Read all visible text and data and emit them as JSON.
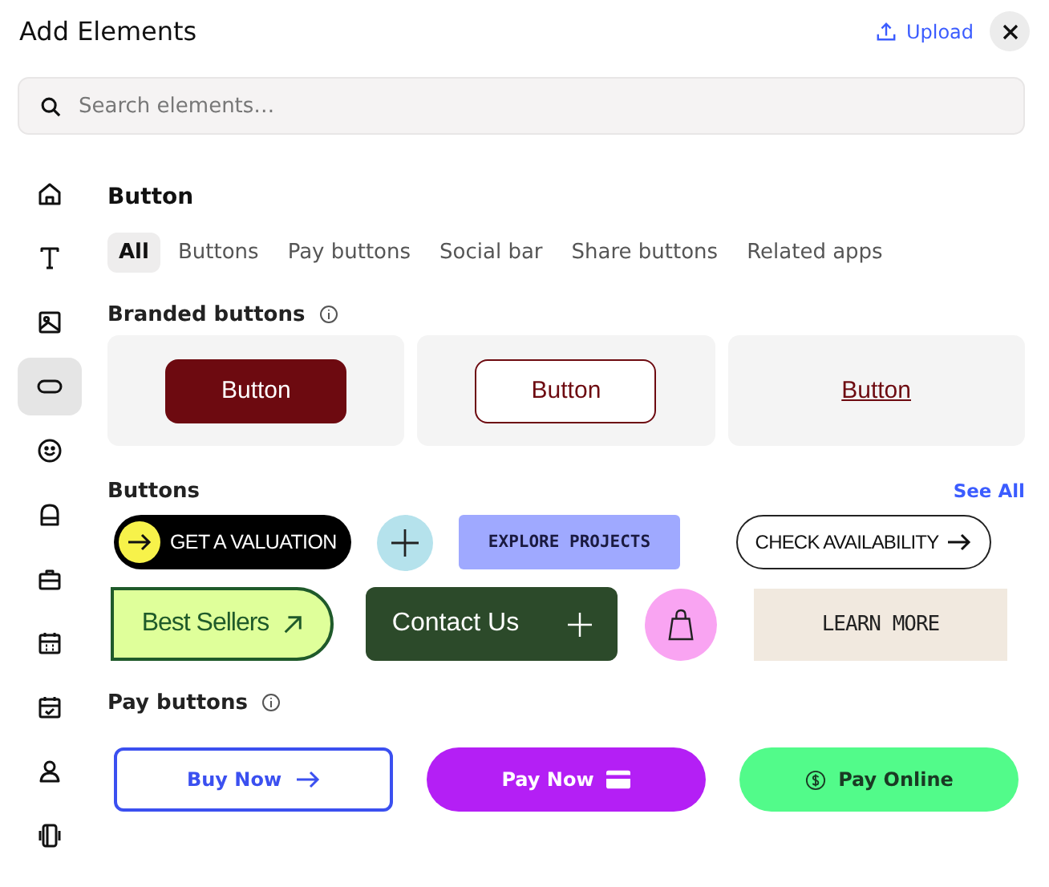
{
  "window": {
    "title": "Add Elements",
    "upload": "Upload"
  },
  "search": {
    "placeholder": "Search elements…"
  },
  "sidebar": {
    "items": [
      {
        "kind": "home",
        "selected": false
      },
      {
        "kind": "text",
        "selected": false
      },
      {
        "kind": "image",
        "selected": false
      },
      {
        "kind": "button",
        "selected": true
      },
      {
        "kind": "smiley",
        "selected": false
      },
      {
        "kind": "bag",
        "selected": false
      },
      {
        "kind": "briefcase",
        "selected": false
      },
      {
        "kind": "calendar",
        "selected": false
      },
      {
        "kind": "calendar-check",
        "selected": false
      },
      {
        "kind": "person",
        "selected": false
      },
      {
        "kind": "phone",
        "selected": false
      }
    ]
  },
  "heading": "Button",
  "tabs": [
    {
      "label": "All",
      "selected": true
    },
    {
      "label": "Buttons",
      "selected": false
    },
    {
      "label": "Pay buttons",
      "selected": false
    },
    {
      "label": "Social bar",
      "selected": false
    },
    {
      "label": "Share buttons",
      "selected": false
    },
    {
      "label": "Related apps",
      "selected": false
    }
  ],
  "branded": {
    "title": "Branded buttons",
    "items": [
      {
        "label": "Button",
        "kind": "filled"
      },
      {
        "label": "Button",
        "kind": "outline"
      },
      {
        "label": "Button",
        "kind": "link"
      }
    ]
  },
  "buttons": {
    "title": "Buttons",
    "see_all": "See All",
    "rows": [
      [
        {
          "label": "GET A VALUATION",
          "kind": "dot-arrow"
        },
        {
          "kind": "plus-circle"
        },
        {
          "label": "EXPLORE PROJECTS",
          "kind": "pixel"
        },
        {
          "label": "CHECK AVAILABILITY",
          "kind": "outline-arrow"
        }
      ],
      [
        {
          "label": "Best Sellers",
          "kind": "lime-arrow"
        },
        {
          "label": "Contact Us",
          "kind": "dark-plus"
        },
        {
          "kind": "bag-circle"
        },
        {
          "label": "LEARN MORE",
          "kind": "beige"
        }
      ]
    ]
  },
  "pay": {
    "title": "Pay buttons",
    "items": [
      {
        "label": "Buy Now",
        "kind": "buy"
      },
      {
        "label": "Pay Now",
        "kind": "card"
      },
      {
        "label": "Pay Online",
        "kind": "online"
      }
    ]
  }
}
